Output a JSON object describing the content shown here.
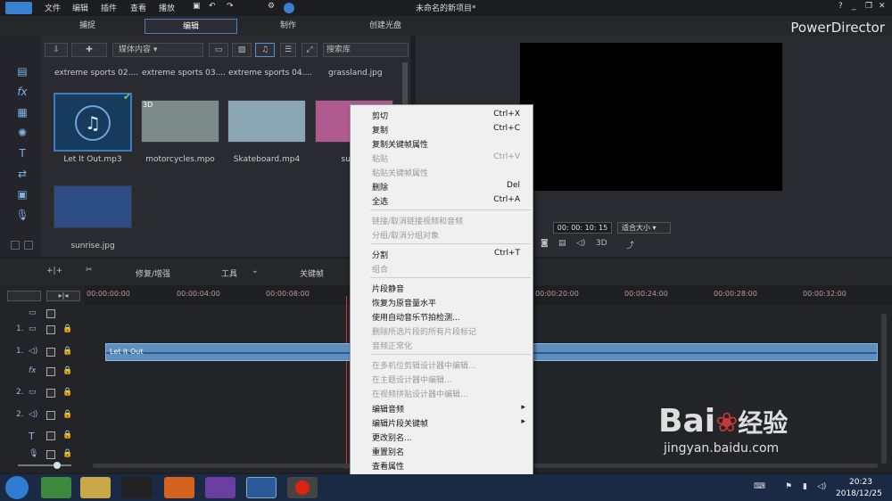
{
  "window": {
    "title": "未命名的新项目*",
    "brand": "PowerDirector"
  },
  "menubar": {
    "items": [
      "文件",
      "编辑",
      "插件",
      "查看",
      "播放"
    ]
  },
  "modes": {
    "capture": "捕捉",
    "edit": "编辑",
    "produce": "制作",
    "disc": "创建光盘"
  },
  "library": {
    "dropdown": "媒体内容",
    "search_placeholder": "搜索库",
    "top_titles": [
      "extreme sports 02....",
      "extreme sports 03....",
      "extreme sports 04....",
      "grassland.jpg"
    ],
    "items": [
      "Let It Out.mp3",
      "motorcycles.mpo",
      "Skateboard.mp4",
      "sunris",
      "sunrise.jpg"
    ],
    "badge_3d": "3D"
  },
  "preview": {
    "timecode": "00: 00: 10: 15",
    "fit": "适合大小",
    "mode3d": "3D"
  },
  "toolbar2": {
    "fix": "修复/增强",
    "tools": "工具",
    "keyframe": "关键帧"
  },
  "timeline": {
    "ruler": [
      "00:00:00:00",
      "00:00:04:00",
      "00:00:08:00",
      "00:00:20:00",
      "00:00:24:00",
      "00:00:28:00",
      "00:00:32:00"
    ],
    "tracks": [
      "1.",
      "1.",
      "",
      "2.",
      "2.",
      "",
      ""
    ],
    "clip_label": "Let It Out"
  },
  "context_menu": {
    "items": [
      {
        "label": "剪切",
        "shortcut": "Ctrl+X",
        "disabled": false
      },
      {
        "label": "复制",
        "shortcut": "Ctrl+C",
        "disabled": false
      },
      {
        "label": "复制关键帧属性",
        "shortcut": "",
        "disabled": false
      },
      {
        "label": "粘贴",
        "shortcut": "Ctrl+V",
        "disabled": true
      },
      {
        "label": "粘贴关键帧属性",
        "shortcut": "",
        "disabled": true
      },
      {
        "label": "删除",
        "shortcut": "Del",
        "disabled": false
      },
      {
        "label": "全选",
        "shortcut": "Ctrl+A",
        "disabled": false
      },
      {
        "label": "链接/取消链接视频和音频",
        "shortcut": "",
        "disabled": true
      },
      {
        "label": "分组/取消分组对象",
        "shortcut": "",
        "disabled": true
      },
      {
        "label": "分割",
        "shortcut": "Ctrl+T",
        "disabled": false
      },
      {
        "label": "组合",
        "shortcut": "",
        "disabled": true
      },
      {
        "label": "片段静音",
        "shortcut": "",
        "disabled": false
      },
      {
        "label": "恢复为原音量水平",
        "shortcut": "",
        "disabled": false
      },
      {
        "label": "使用自动音乐节拍检测...",
        "shortcut": "",
        "disabled": false
      },
      {
        "label": "删除所选片段的所有片段标记",
        "shortcut": "",
        "disabled": true
      },
      {
        "label": "音频正常化",
        "shortcut": "",
        "disabled": true
      },
      {
        "label": "在多机位剪辑设计器中编辑...",
        "shortcut": "",
        "disabled": true
      },
      {
        "label": "在主题设计器中编辑...",
        "shortcut": "",
        "disabled": true
      },
      {
        "label": "在视频拼贴设计器中编辑...",
        "shortcut": "",
        "disabled": true
      },
      {
        "label": "编辑音频",
        "shortcut": "",
        "disabled": false
      },
      {
        "label": "编辑片段关键帧",
        "shortcut": "",
        "disabled": false
      },
      {
        "label": "更改别名...",
        "shortcut": "",
        "disabled": false
      },
      {
        "label": "重置别名",
        "shortcut": "",
        "disabled": false
      },
      {
        "label": "查看属性",
        "shortcut": "",
        "disabled": false
      }
    ]
  },
  "taskbar": {
    "time": "20:23",
    "date": "2018/12/25"
  },
  "watermark": {
    "text1": "Bai",
    "text2": "经验",
    "url": "jingyan.baidu.com"
  }
}
